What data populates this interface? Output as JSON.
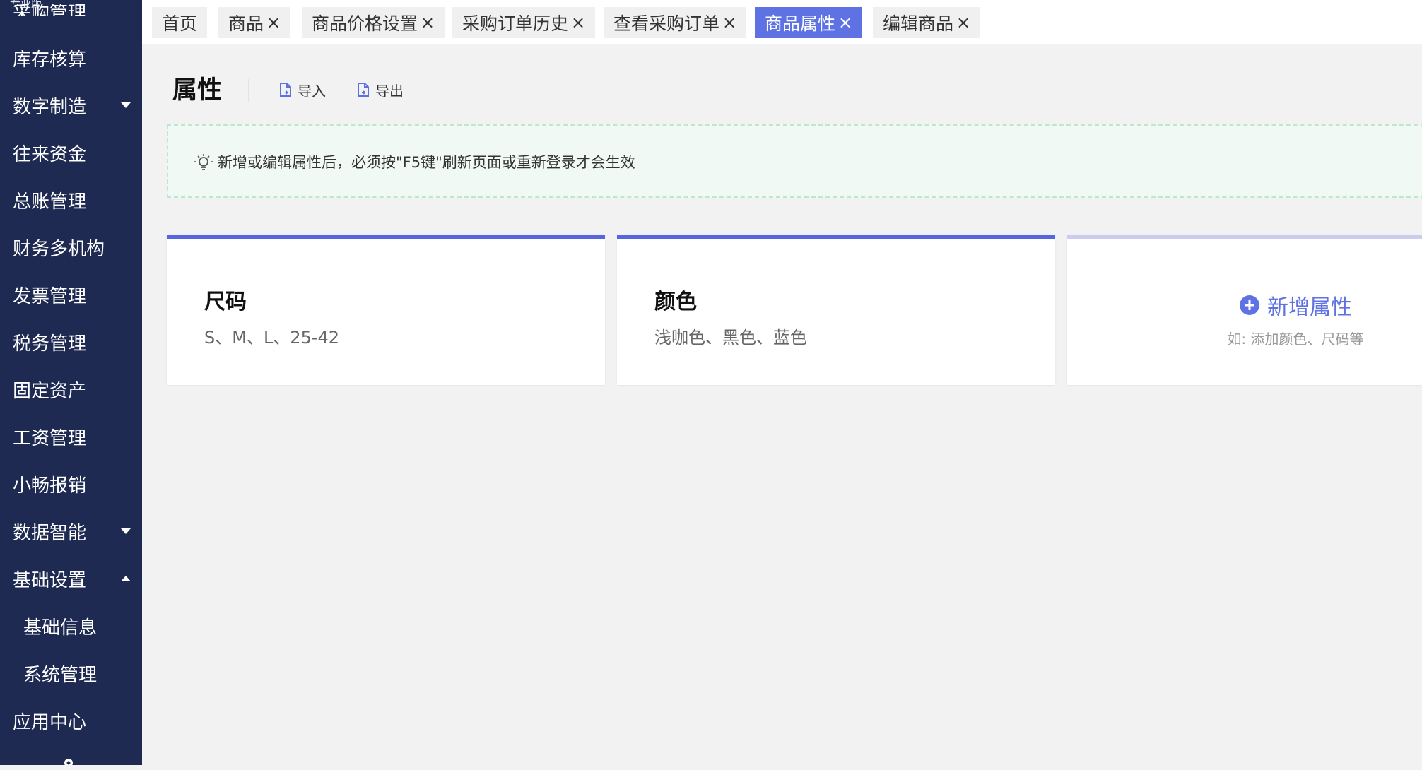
{
  "sidebar": {
    "edition_badge": "专业版",
    "items": [
      {
        "label": "库存核算",
        "arrow": ""
      },
      {
        "label": "数字制造",
        "arrow": "down"
      },
      {
        "label": "往来资金",
        "arrow": ""
      },
      {
        "label": "总账管理",
        "arrow": ""
      },
      {
        "label": "财务多机构",
        "arrow": ""
      },
      {
        "label": "发票管理",
        "arrow": ""
      },
      {
        "label": "税务管理",
        "arrow": ""
      },
      {
        "label": "固定资产",
        "arrow": ""
      },
      {
        "label": "工资管理",
        "arrow": ""
      },
      {
        "label": "小畅报销",
        "arrow": ""
      },
      {
        "label": "数据智能",
        "arrow": "down"
      },
      {
        "label": "基础设置",
        "arrow": "up"
      },
      {
        "label": "基础信息",
        "arrow": "",
        "sub": true
      },
      {
        "label": "系统管理",
        "arrow": "",
        "sub": true
      },
      {
        "label": "应用中心",
        "arrow": ""
      }
    ]
  },
  "tabs": [
    {
      "label": "首页",
      "closable": false,
      "active": false
    },
    {
      "label": "商品",
      "closable": true,
      "active": false
    },
    {
      "label": "商品价格设置",
      "closable": true,
      "active": false
    },
    {
      "label": "采购订单历史",
      "closable": true,
      "active": false
    },
    {
      "label": "查看采购订单",
      "closable": true,
      "active": false
    },
    {
      "label": "商品属性",
      "closable": true,
      "active": true
    },
    {
      "label": "编辑商品",
      "closable": true,
      "active": false
    }
  ],
  "tab_close_glyph": "×",
  "page": {
    "title": "属性",
    "import_label": "导入",
    "export_label": "导出"
  },
  "notice": {
    "text": "新增或编辑属性后，必须按\"F5键\"刷新页面或重新登录才会生效"
  },
  "attributes": [
    {
      "name": "尺码",
      "values": "S、M、L、25-42"
    },
    {
      "name": "颜色",
      "values": "浅咖色、黑色、蓝色"
    }
  ],
  "add_card": {
    "label": "新增属性",
    "hint": "如: 添加颜色、尺码等"
  },
  "colors": {
    "sidebar_bg": "#1e2a52",
    "accent": "#5e72e4",
    "card_border": "#5865e0",
    "notice_bg": "#f1f9f5",
    "notice_border": "#bfe6d0"
  },
  "icons": {
    "import": "file-import-icon",
    "export": "file-export-icon",
    "notice": "lightbulb-icon",
    "add": "plus-circle-icon",
    "menu_arrow": "caret-icon"
  }
}
